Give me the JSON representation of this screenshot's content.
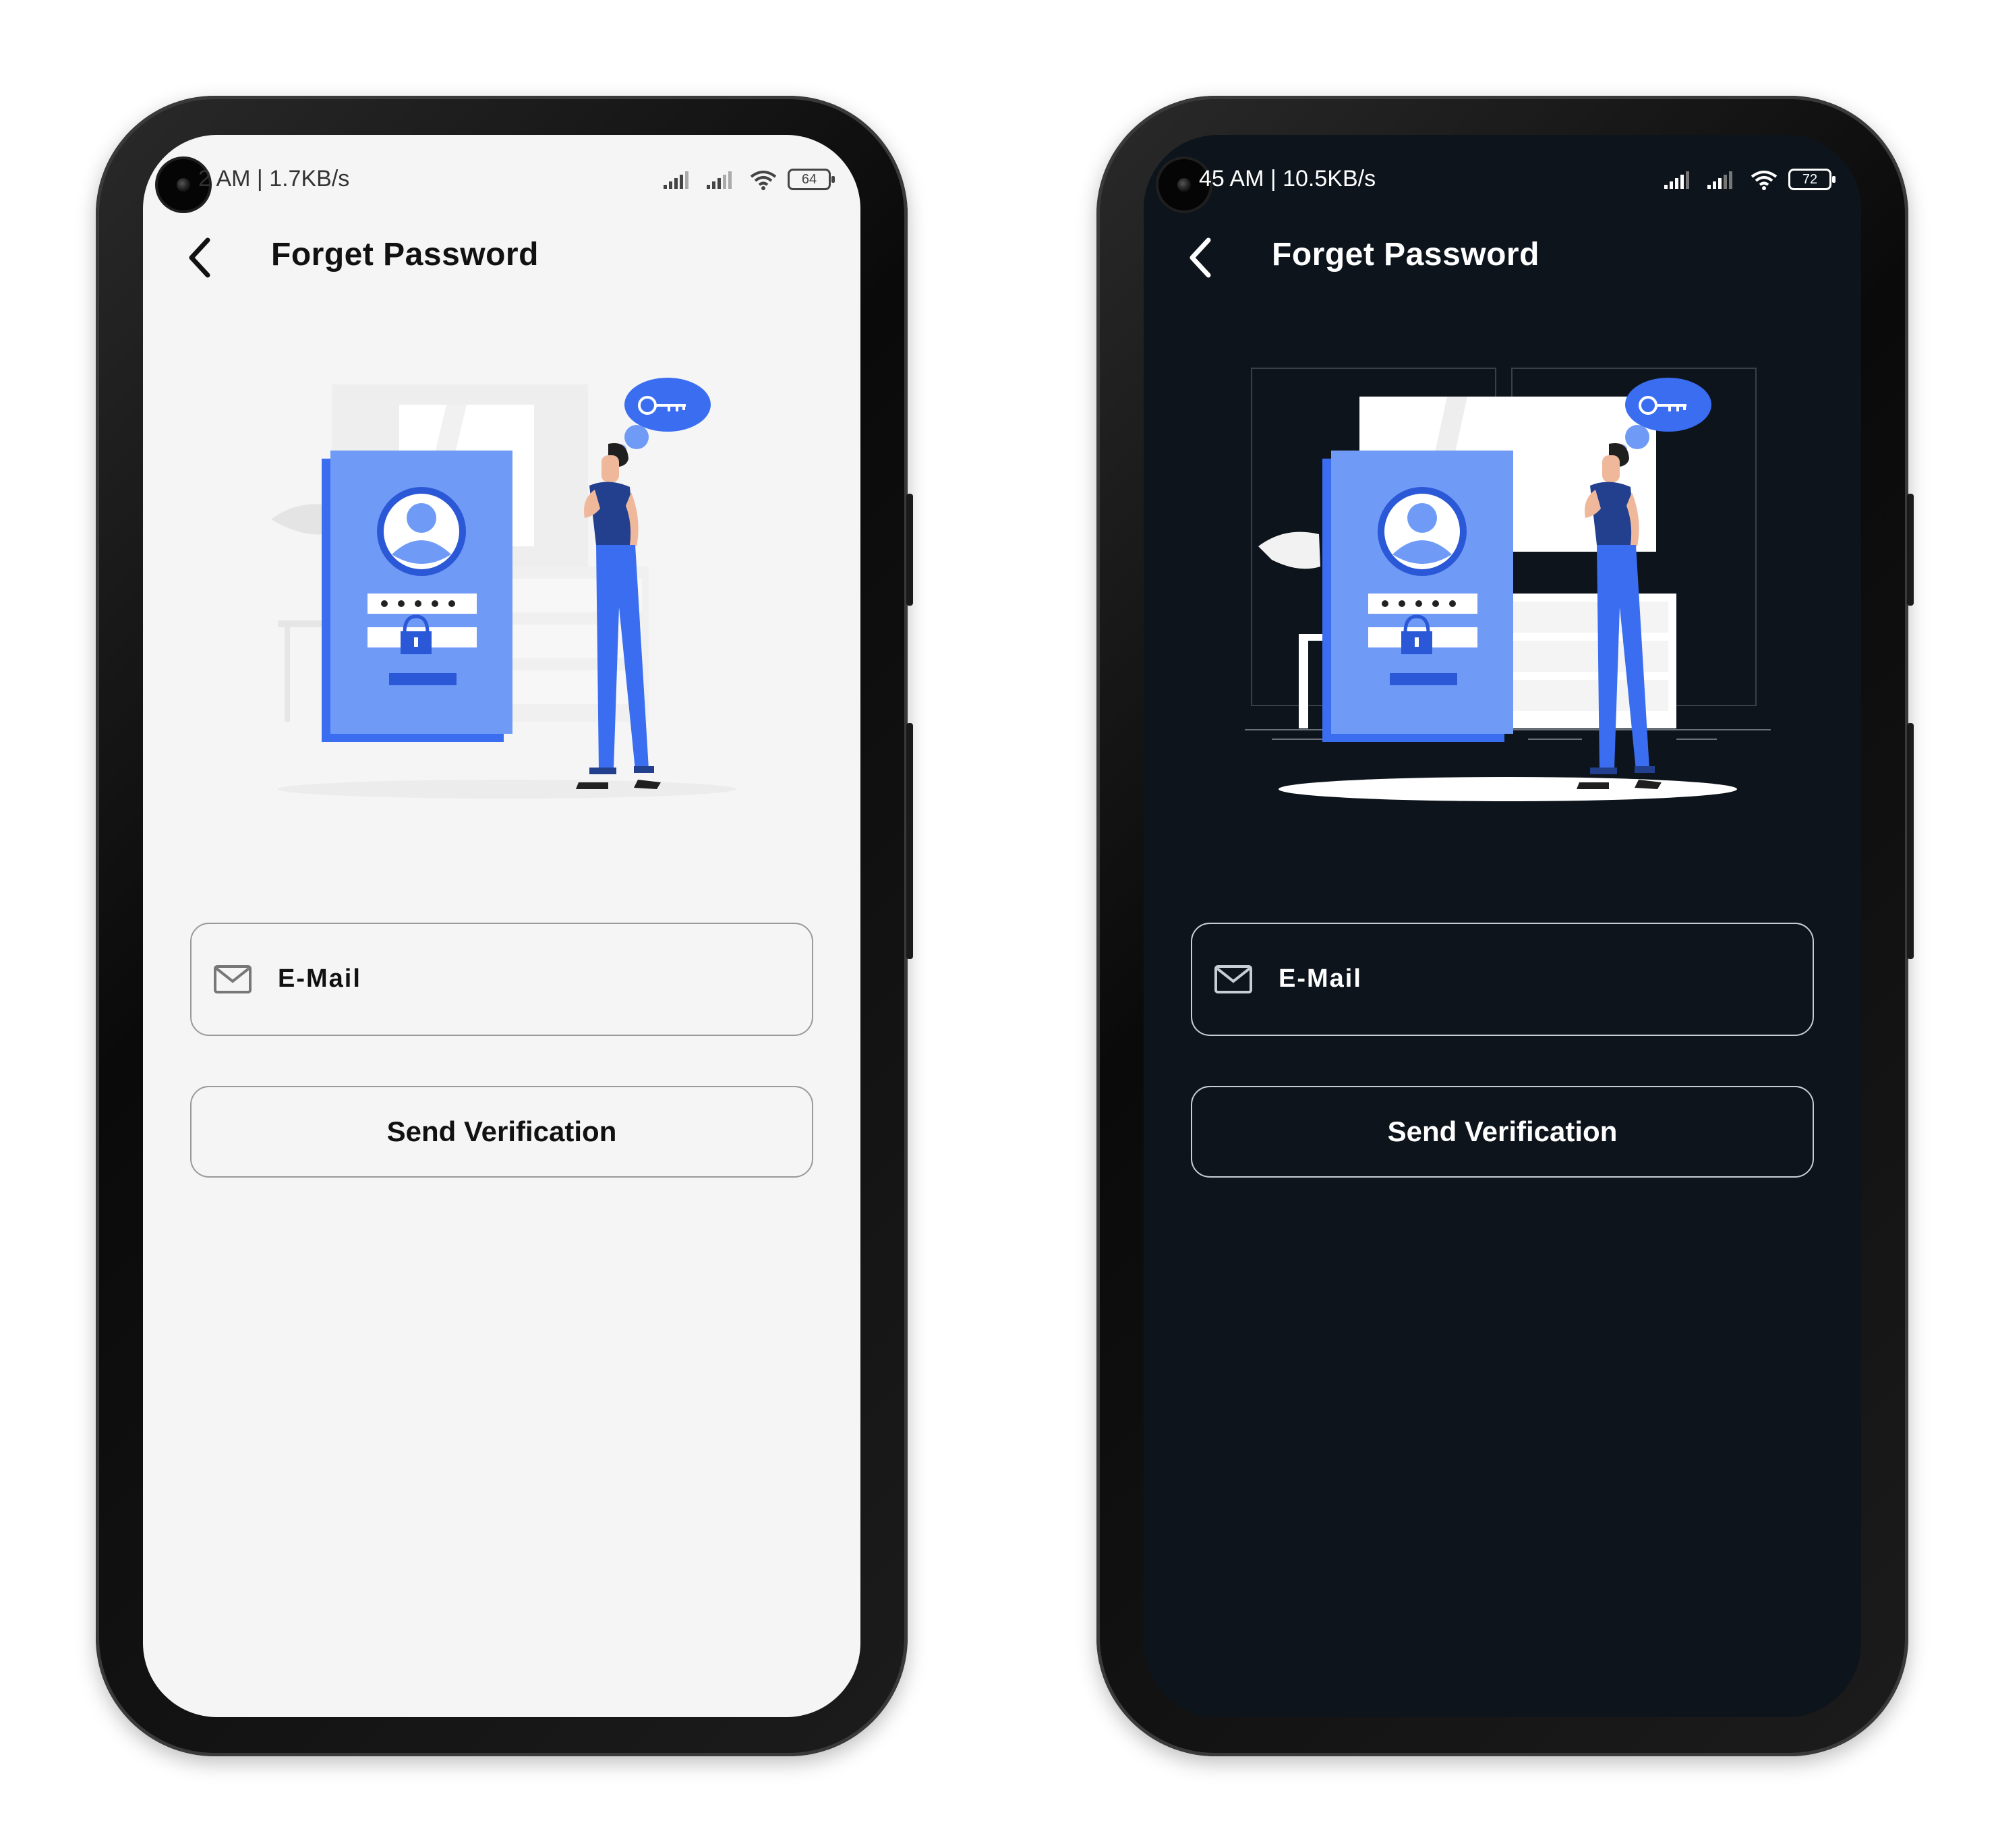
{
  "screens": [
    {
      "theme": "light",
      "status": {
        "text": "2 AM | 1.7KB/s",
        "battery": "64"
      },
      "header": {
        "title": "Forget Password"
      },
      "form": {
        "email_label": "E-Mail",
        "send_label": "Send Verification"
      }
    },
    {
      "theme": "dark",
      "status": {
        "text": "45 AM | 10.5KB/s",
        "battery": "72"
      },
      "header": {
        "title": "Forget Password"
      },
      "form": {
        "email_label": "E-Mail",
        "send_label": "Send Verification"
      }
    }
  ],
  "colors": {
    "accent": "#5a86f5",
    "accent_dark": "#3a6df0",
    "shirt": "#23408f",
    "light_bg": "#f5f5f5",
    "dark_bg": "#0d141c"
  }
}
